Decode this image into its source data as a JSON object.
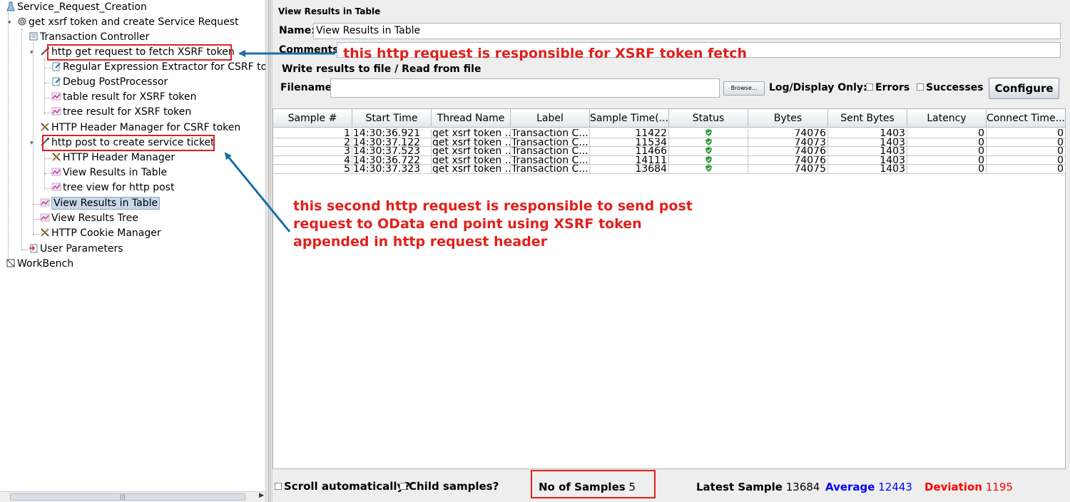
{
  "tree": {
    "nodes": [
      {
        "label": "Service_Request_Creation",
        "icon": "testplan-icon"
      },
      {
        "label": "get xsrf token and create Service Request",
        "icon": "thread-group-gear-icon"
      },
      {
        "label": "Transaction Controller",
        "icon": "transaction-controller-icon"
      },
      {
        "label": "http get request to fetch XSRF token",
        "icon": "pipette-sampler-icon"
      },
      {
        "label": "Regular Expression Extractor for CSRF tok",
        "icon": "postprocessor-icon"
      },
      {
        "label": "Debug PostProcessor",
        "icon": "postprocessor-icon"
      },
      {
        "label": "table result for XSRF token",
        "icon": "listener-graph-icon"
      },
      {
        "label": "tree result for XSRF token",
        "icon": "listener-graph-icon"
      },
      {
        "label": "HTTP Header Manager for CSRF token",
        "icon": "config-tools-icon"
      },
      {
        "label": "http post to create service ticket",
        "icon": "pipette-sampler-icon"
      },
      {
        "label": "HTTP Header Manager",
        "icon": "config-tools-icon"
      },
      {
        "label": "View Results in Table",
        "icon": "listener-graph-icon"
      },
      {
        "label": "tree view for http post",
        "icon": "listener-graph-icon"
      },
      {
        "label": "View Results in Table",
        "icon": "listener-graph-icon"
      },
      {
        "label": "View Results Tree",
        "icon": "listener-graph-icon"
      },
      {
        "label": "HTTP Cookie Manager",
        "icon": "config-tools-icon"
      },
      {
        "label": "User Parameters",
        "icon": "preprocessor-icon"
      },
      {
        "label": "WorkBench",
        "icon": "workbench-icon"
      }
    ]
  },
  "panel": {
    "title": "View Results in Table",
    "name_label": "Name:",
    "name_value": "View Results in Table",
    "comments_label": "Comments:",
    "file_group_label": "Write results to file / Read from file",
    "filename_label": "Filename",
    "filename_value": "",
    "browse_label": "Browse...",
    "log_display_label": "Log/Display Only:",
    "errors_label": "Errors",
    "successes_label": "Successes",
    "configure_label": "Configure"
  },
  "table": {
    "columns": [
      "Sample #",
      "Start Time",
      "Thread Name",
      "Label",
      "Sample Time(...",
      "Status",
      "Bytes",
      "Sent Bytes",
      "Latency",
      "Connect Time..."
    ],
    "rows": [
      {
        "sample": "1",
        "start": "14:30:36.921",
        "thread": "get xsrf token ...",
        "label": "Transaction C...",
        "time": "11422",
        "status": "success",
        "bytes": "74076",
        "sent": "1403",
        "latency": "0",
        "connect": "0"
      },
      {
        "sample": "2",
        "start": "14:30:37.122",
        "thread": "get xsrf token ...",
        "label": "Transaction C...",
        "time": "11534",
        "status": "success",
        "bytes": "74073",
        "sent": "1403",
        "latency": "0",
        "connect": "0"
      },
      {
        "sample": "3",
        "start": "14:30:37.523",
        "thread": "get xsrf token ...",
        "label": "Transaction C...",
        "time": "11466",
        "status": "success",
        "bytes": "74076",
        "sent": "1403",
        "latency": "0",
        "connect": "0"
      },
      {
        "sample": "4",
        "start": "14:30:36.722",
        "thread": "get xsrf token ...",
        "label": "Transaction C...",
        "time": "14111",
        "status": "success",
        "bytes": "74076",
        "sent": "1403",
        "latency": "0",
        "connect": "0"
      },
      {
        "sample": "5",
        "start": "14:30:37.323",
        "thread": "get xsrf token ...",
        "label": "Transaction C...",
        "time": "13684",
        "status": "success",
        "bytes": "74075",
        "sent": "1403",
        "latency": "0",
        "connect": "0"
      }
    ]
  },
  "footer": {
    "scroll_label": "Scroll automatically?",
    "child_label": "Child samples?",
    "samples_label": "No of Samples",
    "samples_value": "5",
    "latest_label": "Latest Sample",
    "latest_value": "13684",
    "average_label": "Average",
    "average_value": "12443",
    "deviation_label": "Deviation",
    "deviation_value": "1195"
  },
  "annotations": {
    "first": "this http request is responsible for XSRF token fetch",
    "second_lines": [
      "this second http request is responsible to send post",
      "request to OData end point using XSRF token",
      "appended in http request header"
    ]
  },
  "colors": {
    "annotation_red": "#e0211c",
    "arrow_blue": "#1d6fa5",
    "average_blue": "#0000ff",
    "deviation_red": "#ff0000",
    "success_green": "#2e9e3a"
  }
}
